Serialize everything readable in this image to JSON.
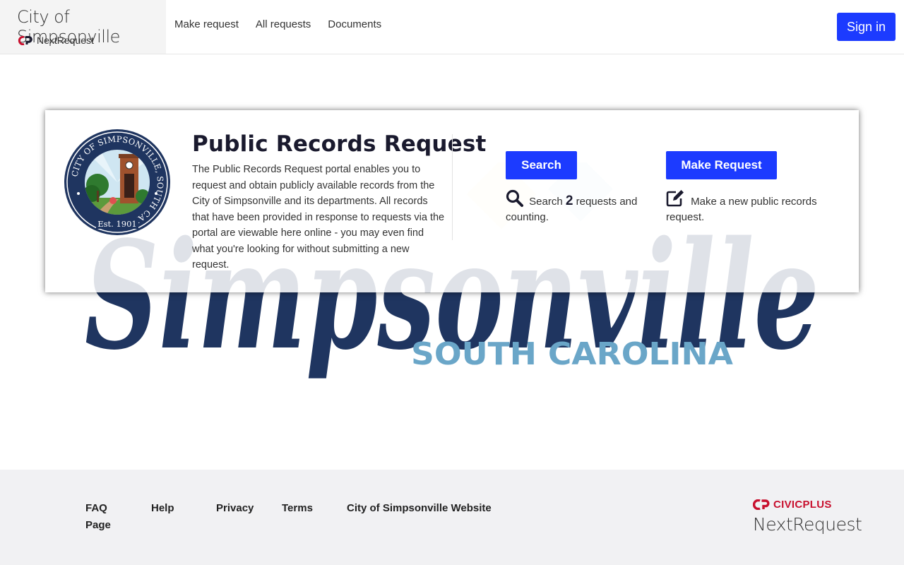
{
  "header": {
    "org_name": "City of Simpsonville",
    "platform_name": "NextRequest",
    "nav": [
      "Make request",
      "All requests",
      "Documents"
    ],
    "signin_label": "Sign in"
  },
  "watermark": {
    "script_text": "Simpsonville",
    "state_text": "SOUTH CAROLINA"
  },
  "card": {
    "seal_ring_text": "CITY OF SIMPSONVILLE, SOUTH CAROLINA",
    "seal_est": "Est. 1901",
    "title": "Public Records Request",
    "description": "The Public Records Request portal enables you to request and obtain publicly available records from the City of Simpsonville and its departments. All records that have been provided in response to requests via the portal are viewable here online - you may even find what you're looking for without submitting a new request.",
    "search_button": "Search",
    "search_prefix": "Search",
    "request_count": "2",
    "search_suffix": "requests and counting.",
    "make_button": "Make Request",
    "make_info": "Make a new public records request."
  },
  "footer": {
    "links": [
      "FAQ Page",
      "Help",
      "Privacy",
      "Terms",
      "City of Simpsonville Website"
    ],
    "vendor_name": "CIVICPLUS",
    "vendor_product": "NextRequest"
  },
  "colors": {
    "primary": "#1c3bff",
    "navy": "#1f3560",
    "light_blue": "#6aa6c8",
    "civicplus_red": "#c8102e"
  }
}
